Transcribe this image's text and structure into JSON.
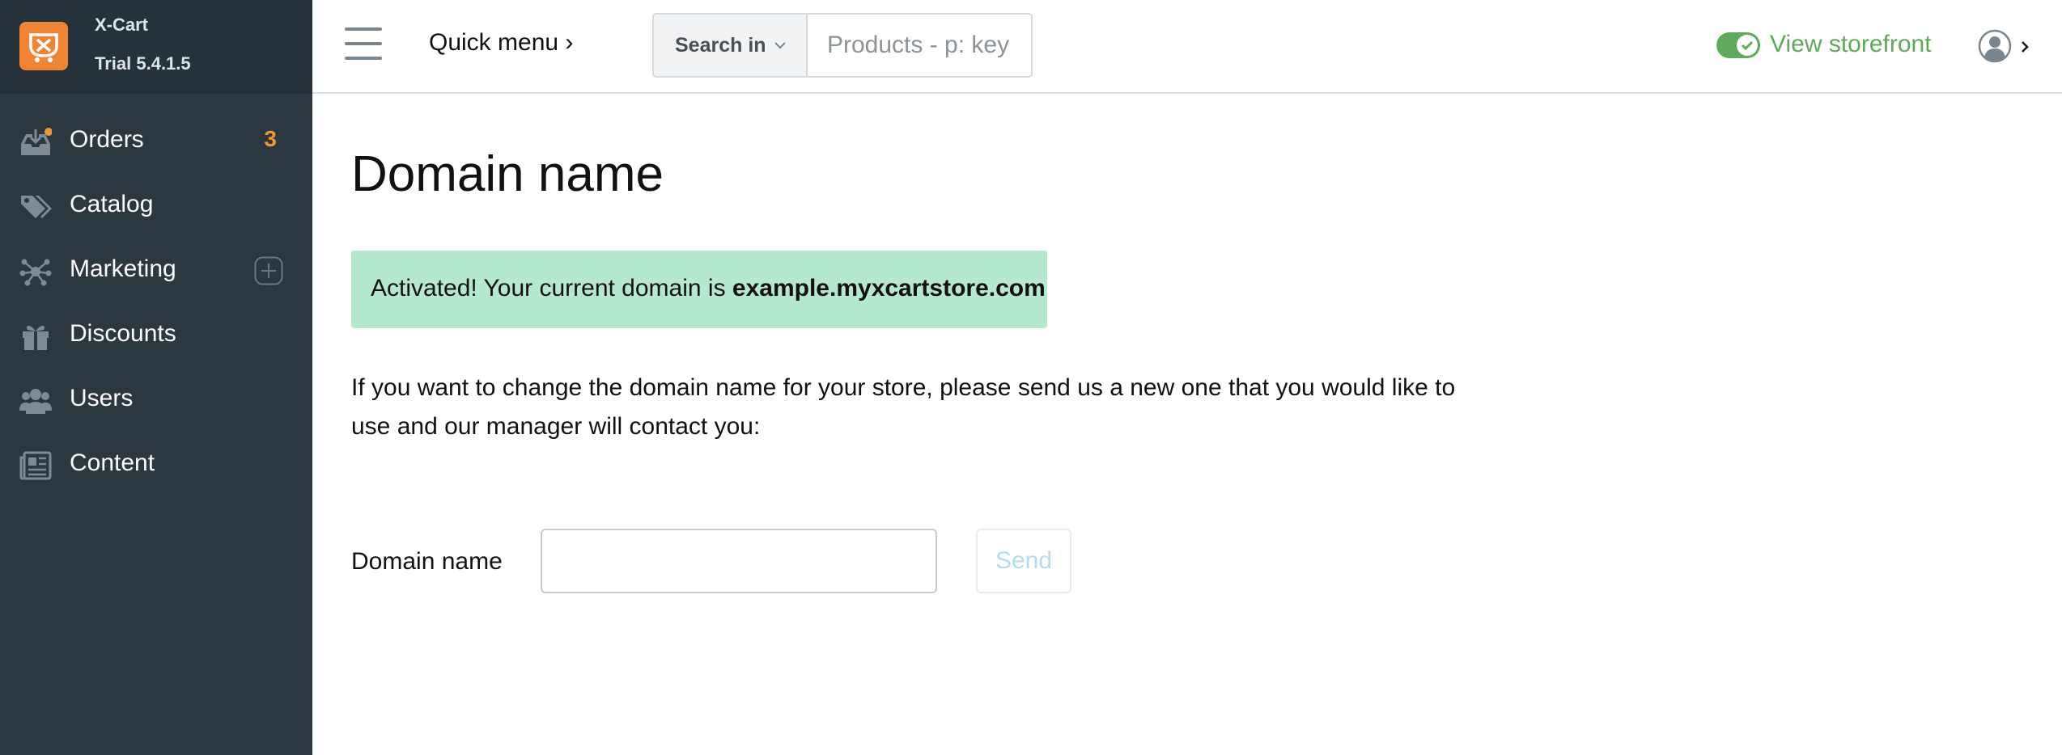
{
  "brand": {
    "name": "X-Cart",
    "version": "Trial 5.4.1.5"
  },
  "sidebar": {
    "items": [
      {
        "label": "Orders",
        "badge": "3",
        "icon": "orders-inbox-icon"
      },
      {
        "label": "Catalog",
        "icon": "tags-icon"
      },
      {
        "label": "Marketing",
        "icon": "network-icon",
        "action_icon": "plus-circle-icon"
      },
      {
        "label": "Discounts",
        "icon": "gift-icon"
      },
      {
        "label": "Users",
        "icon": "users-icon"
      },
      {
        "label": "Content",
        "icon": "newspaper-icon"
      }
    ]
  },
  "header": {
    "quick_menu": "Quick menu ›",
    "search_in": "Search in",
    "search_placeholder": "Products - p: key",
    "storefront_label": "View storefront",
    "storefront_enabled": true
  },
  "page": {
    "title": "Domain name",
    "alert_prefix": "Activated! Your current domain is ",
    "alert_domain": "example.myxcartstore.com",
    "description": "If you want to change the domain name for your store, please send us a new one that you would like to use and our manager will contact you:",
    "form": {
      "label": "Domain name",
      "value": "",
      "send_label": "Send"
    }
  },
  "colors": {
    "sidebar_bg": "#2b3840",
    "accent_orange": "#ef8435",
    "badge_orange": "#f0972d",
    "success_green": "#5daa5b",
    "alert_bg": "#b4e8cf"
  }
}
